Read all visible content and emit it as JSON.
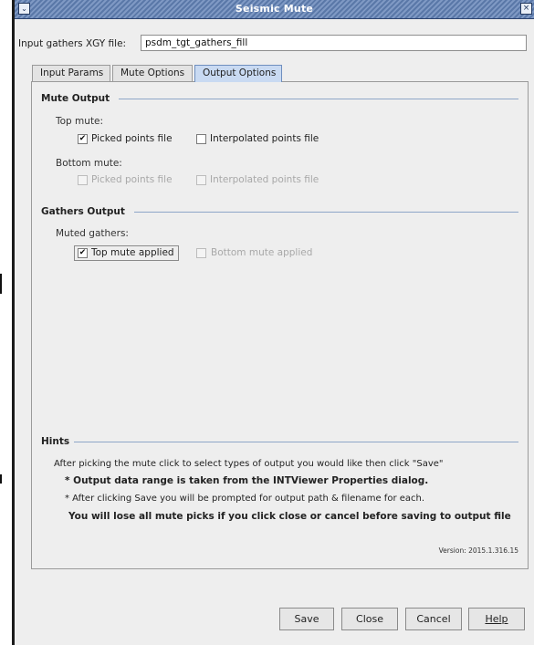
{
  "window": {
    "title": "Seismic Mute",
    "menu_glyph": "⌄",
    "close_glyph": "×"
  },
  "input_file": {
    "label": "Input gathers XGY file:",
    "value": "psdm_tgt_gathers_fill"
  },
  "tabs": [
    {
      "label": "Input Params",
      "active": false
    },
    {
      "label": "Mute Options",
      "active": false
    },
    {
      "label": "Output Options",
      "active": true
    }
  ],
  "mute_output": {
    "title": "Mute Output",
    "top_mute": {
      "label": "Top mute:",
      "picked": {
        "label": "Picked points file",
        "checked": true,
        "enabled": true
      },
      "interpolated": {
        "label": "Interpolated points file",
        "checked": false,
        "enabled": true
      }
    },
    "bottom_mute": {
      "label": "Bottom mute:",
      "picked": {
        "label": "Picked points file",
        "checked": false,
        "enabled": false
      },
      "interpolated": {
        "label": "Interpolated points file",
        "checked": false,
        "enabled": false
      }
    }
  },
  "gathers_output": {
    "title": "Gathers Output",
    "muted_label": "Muted gathers:",
    "top_applied": {
      "label": "Top mute applied",
      "checked": true,
      "enabled": true
    },
    "bottom_applied": {
      "label": "Bottom mute applied",
      "checked": false,
      "enabled": false
    }
  },
  "hints": {
    "title": "Hints",
    "line1": "After picking the mute click to select types of output you would like then click \"Save\"",
    "line2": "* Output data range is taken from the INTViewer Properties dialog.",
    "line3": "* After clicking Save you will be prompted for output path & filename for each.",
    "line4": "You will lose all mute picks if you click close or cancel before saving to output file"
  },
  "version": "Version: 2015.1.316.15",
  "buttons": {
    "save": "Save",
    "close": "Close",
    "cancel": "Cancel",
    "help": "Help"
  },
  "colors": {
    "titlebar": "#5a78a8",
    "active_tab": "#c9daf2",
    "section_line": "#8ea6c8"
  }
}
